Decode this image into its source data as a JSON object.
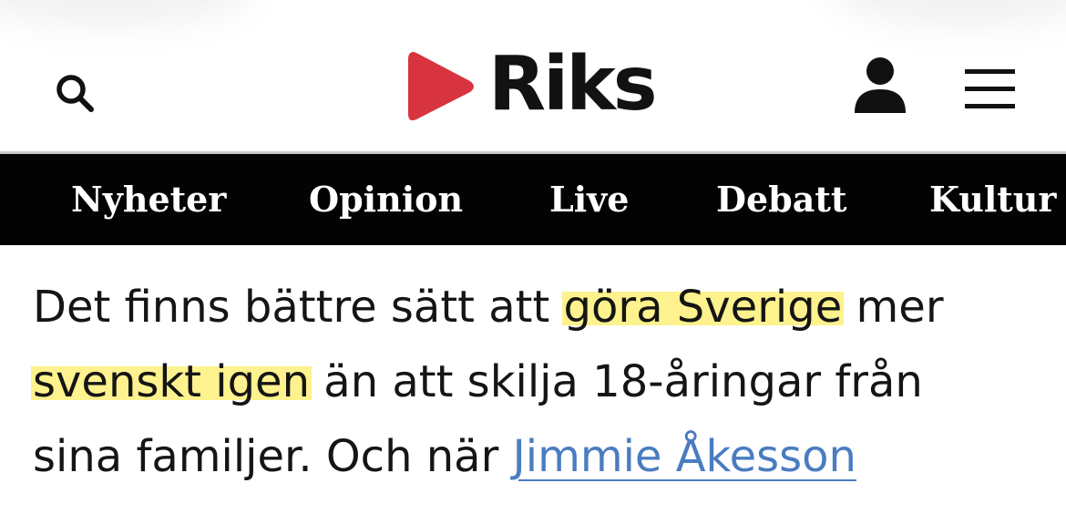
{
  "header": {
    "logo_text": "Riks",
    "logo_accent_color": "#d8343f",
    "icons": {
      "search": "search-icon",
      "user": "user-icon",
      "menu": "hamburger-menu-icon"
    }
  },
  "nav": {
    "background": "#030303",
    "items": [
      "Nyheter",
      "Opinion",
      "Live",
      "Debatt",
      "Kultur"
    ]
  },
  "article": {
    "line1": {
      "text_before": "Det finns bättre sätt att ",
      "highlight": "göra Sverige",
      "text_after": " mer"
    },
    "line2": {
      "highlight": "svenskt igen",
      "text_after": " än att skilja 18-åringar från"
    },
    "line3": {
      "text_before": "sina familjer. Och när ",
      "link": "Jimmie Åkesson"
    },
    "highlight_color": "#fdf28e",
    "link_color": "#4a7cc1"
  }
}
